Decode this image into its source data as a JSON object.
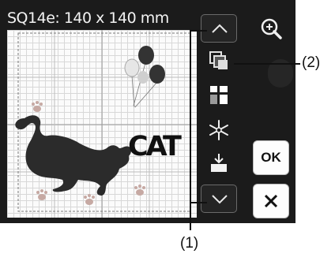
{
  "hoop": {
    "size_label": "SQ14e: 140 x 140 mm"
  },
  "design": {
    "text": "CAT"
  },
  "buttons": {
    "scroll_up_icon": "chevron-up-icon",
    "scroll_down_icon": "chevron-down-icon",
    "zoom_icon": "zoom-in-icon",
    "ok_label": "OK",
    "cancel_icon": "close-icon"
  },
  "tools": [
    "duplicate-icon",
    "layout-icon",
    "snowflake-icon",
    "stamp-icon"
  ],
  "callouts": {
    "one": "(1)",
    "two": "(2)"
  },
  "colors": {
    "screen": "#1b1b1b",
    "canvas": "#fbfbfb",
    "grid": "#d8d8d8",
    "button_border": "#6a6a6a"
  }
}
